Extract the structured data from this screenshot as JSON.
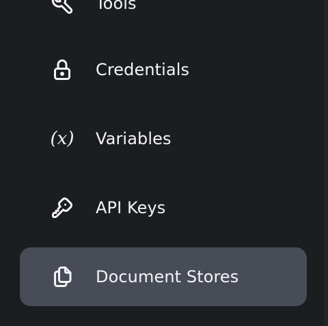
{
  "sidebar": {
    "items": [
      {
        "label": "Tools",
        "icon": "tool-icon",
        "active": false
      },
      {
        "label": "Credentials",
        "icon": "lock-icon",
        "active": false
      },
      {
        "label": "Variables",
        "icon": "variable-icon",
        "icon_text": "(x)",
        "active": false
      },
      {
        "label": "API Keys",
        "icon": "key-icon",
        "active": false
      },
      {
        "label": "Document Stores",
        "icon": "files-icon",
        "active": true
      }
    ]
  },
  "colors": {
    "background": "#1c1d21",
    "active_item": "#474c57",
    "text": "#f3f4f6"
  }
}
